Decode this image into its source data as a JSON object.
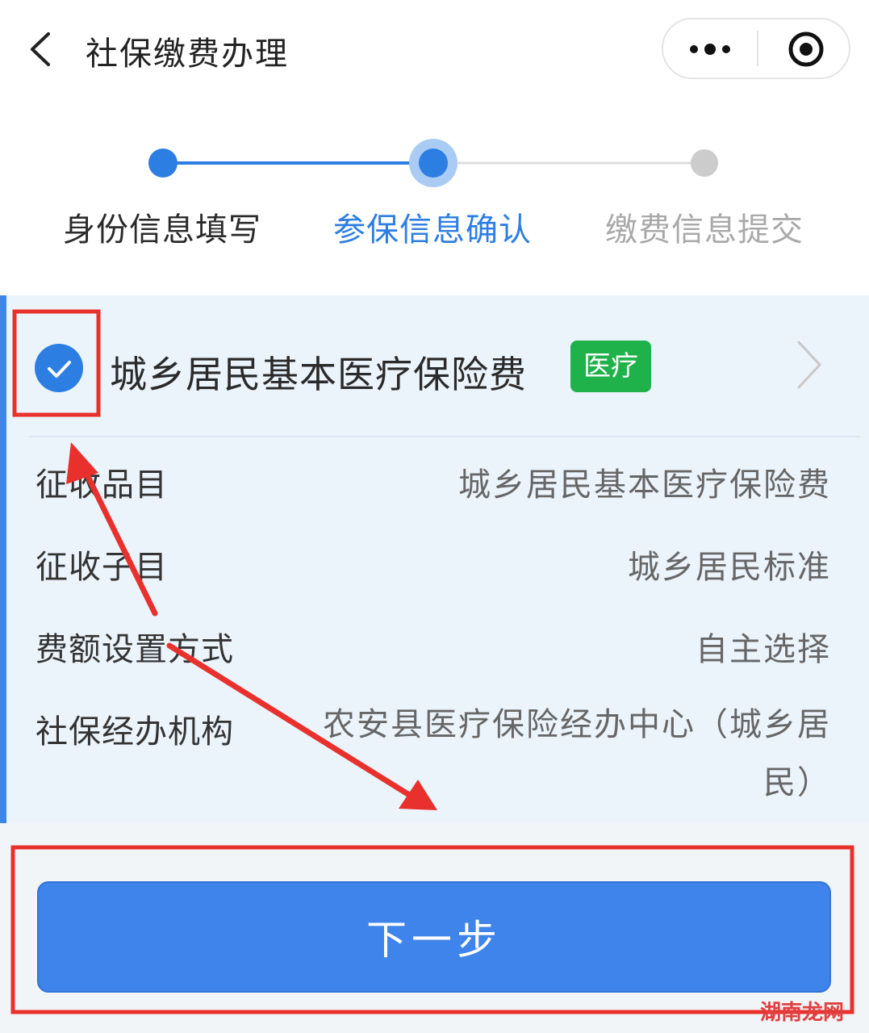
{
  "header": {
    "title": "社保缴费办理",
    "back_icon": "chevron-left-icon",
    "more_icon": "more-dots-icon",
    "close_icon": "target-close-icon"
  },
  "steps": [
    {
      "label": "身份信息填写",
      "state": "done"
    },
    {
      "label": "参保信息确认",
      "state": "current"
    },
    {
      "label": "缴费信息提交",
      "state": "pending"
    }
  ],
  "card": {
    "checked": true,
    "title": "城乡居民基本医疗保险费",
    "tag": "医疗",
    "rows": [
      {
        "label": "征收品目",
        "value": "城乡居民基本医疗保险费"
      },
      {
        "label": "征收子目",
        "value": "城乡居民标准"
      },
      {
        "label": "费额设置方式",
        "value": "自主选择"
      },
      {
        "label": "社保经办机构",
        "value": "农安县医疗保险经办中心（城乡居民）"
      }
    ]
  },
  "next_button": {
    "label": "下一步"
  },
  "watermark": "湖南龙网",
  "colors": {
    "primary": "#3e84ea",
    "step_active": "#2d7ee3",
    "step_pending": "#cccccc",
    "tag_green": "#1fb24a",
    "annotation_red": "#e8312c",
    "card_bg": "#ebf3fb"
  }
}
